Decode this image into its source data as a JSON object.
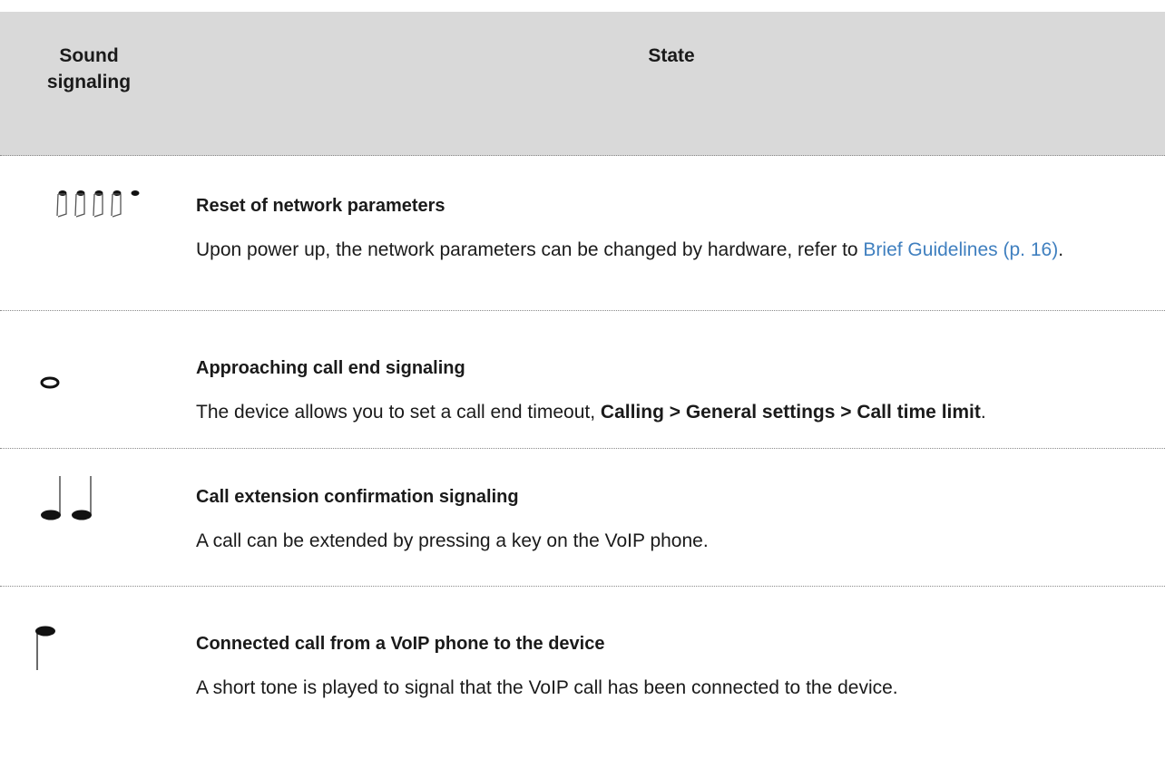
{
  "table": {
    "header": {
      "sound_line1": "Sound",
      "sound_line2": "signaling",
      "state": "State"
    },
    "rows": [
      {
        "icon": "four-eighth-notes-icon",
        "title": "Reset of network parameters",
        "desc_before": "Upon power up, the network parameters can be changed by hardware, refer to ",
        "link": "Brief Guidelines (p. 16)",
        "desc_after": "."
      },
      {
        "icon": "whole-note-icon",
        "title": "Approaching call end signaling",
        "desc_before": "The device allows you to set a call end timeout, ",
        "bold_path": "Calling > General settings > Call time limit",
        "desc_after": "."
      },
      {
        "icon": "two-quarter-notes-icon",
        "title": "Call extension confirmation signaling",
        "desc": "A call can be extended by pressing a key on the VoIP phone."
      },
      {
        "icon": "single-inverted-quarter-note-icon",
        "title": "Connected call from a VoIP phone to the device",
        "desc": "A short tone is played to signal that the VoIP call has been connected to the device."
      }
    ]
  }
}
